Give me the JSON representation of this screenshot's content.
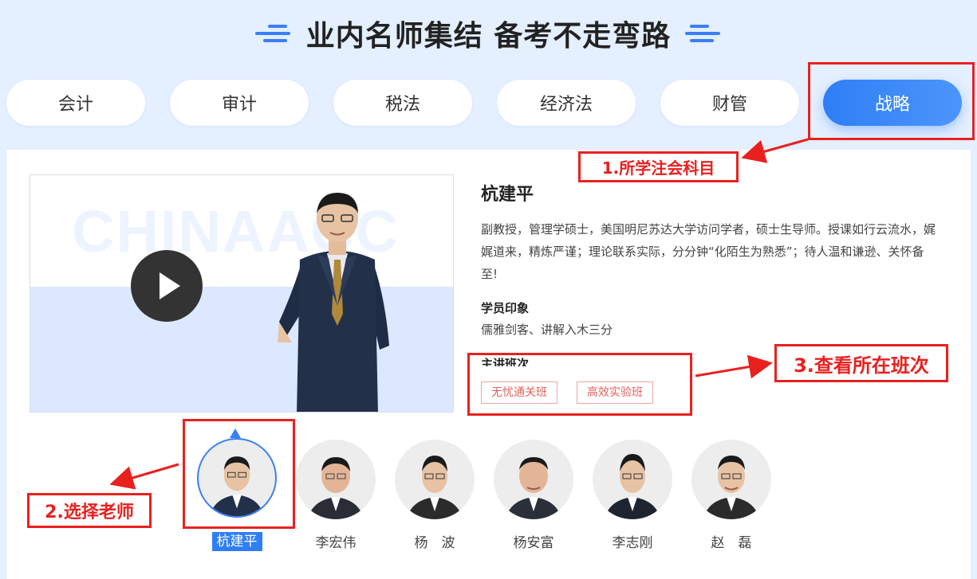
{
  "header": {
    "title": "业内名师集结 备考不走弯路"
  },
  "tabs": [
    {
      "label": "会计"
    },
    {
      "label": "审计"
    },
    {
      "label": "税法"
    },
    {
      "label": "经济法"
    },
    {
      "label": "财管"
    },
    {
      "label": "战略",
      "active": true
    }
  ],
  "video": {
    "watermark": "CHINAACC"
  },
  "teacher_detail": {
    "name": "杭建平",
    "description": "副教授，管理学硕士，美国明尼苏达大学访问学者，硕士生导师。授课如行云流水，娓娓道来，精炼严谨；理论联系实际，分分钟“化陌生为熟悉”；待人温和谦逊、关怀备至!",
    "impression_label": "学员印象",
    "impression": "儒雅剑客、讲解入木三分",
    "classes_label": "主讲班次",
    "classes": [
      "无忧通关班",
      "高效实验班"
    ]
  },
  "teachers": [
    {
      "name": "杭建平",
      "selected": true
    },
    {
      "name": "李宏伟"
    },
    {
      "name": "杨　波"
    },
    {
      "name": "杨安富"
    },
    {
      "name": "李志刚"
    },
    {
      "name": "赵　磊"
    }
  ],
  "annotations": {
    "step1": "1.所学注会科目",
    "step2": "2.选择老师",
    "step3": "3.查看所在班次"
  },
  "colors": {
    "accent": "#2f7ef6",
    "annotation": "#e8211f",
    "tag": "#e4605c"
  }
}
